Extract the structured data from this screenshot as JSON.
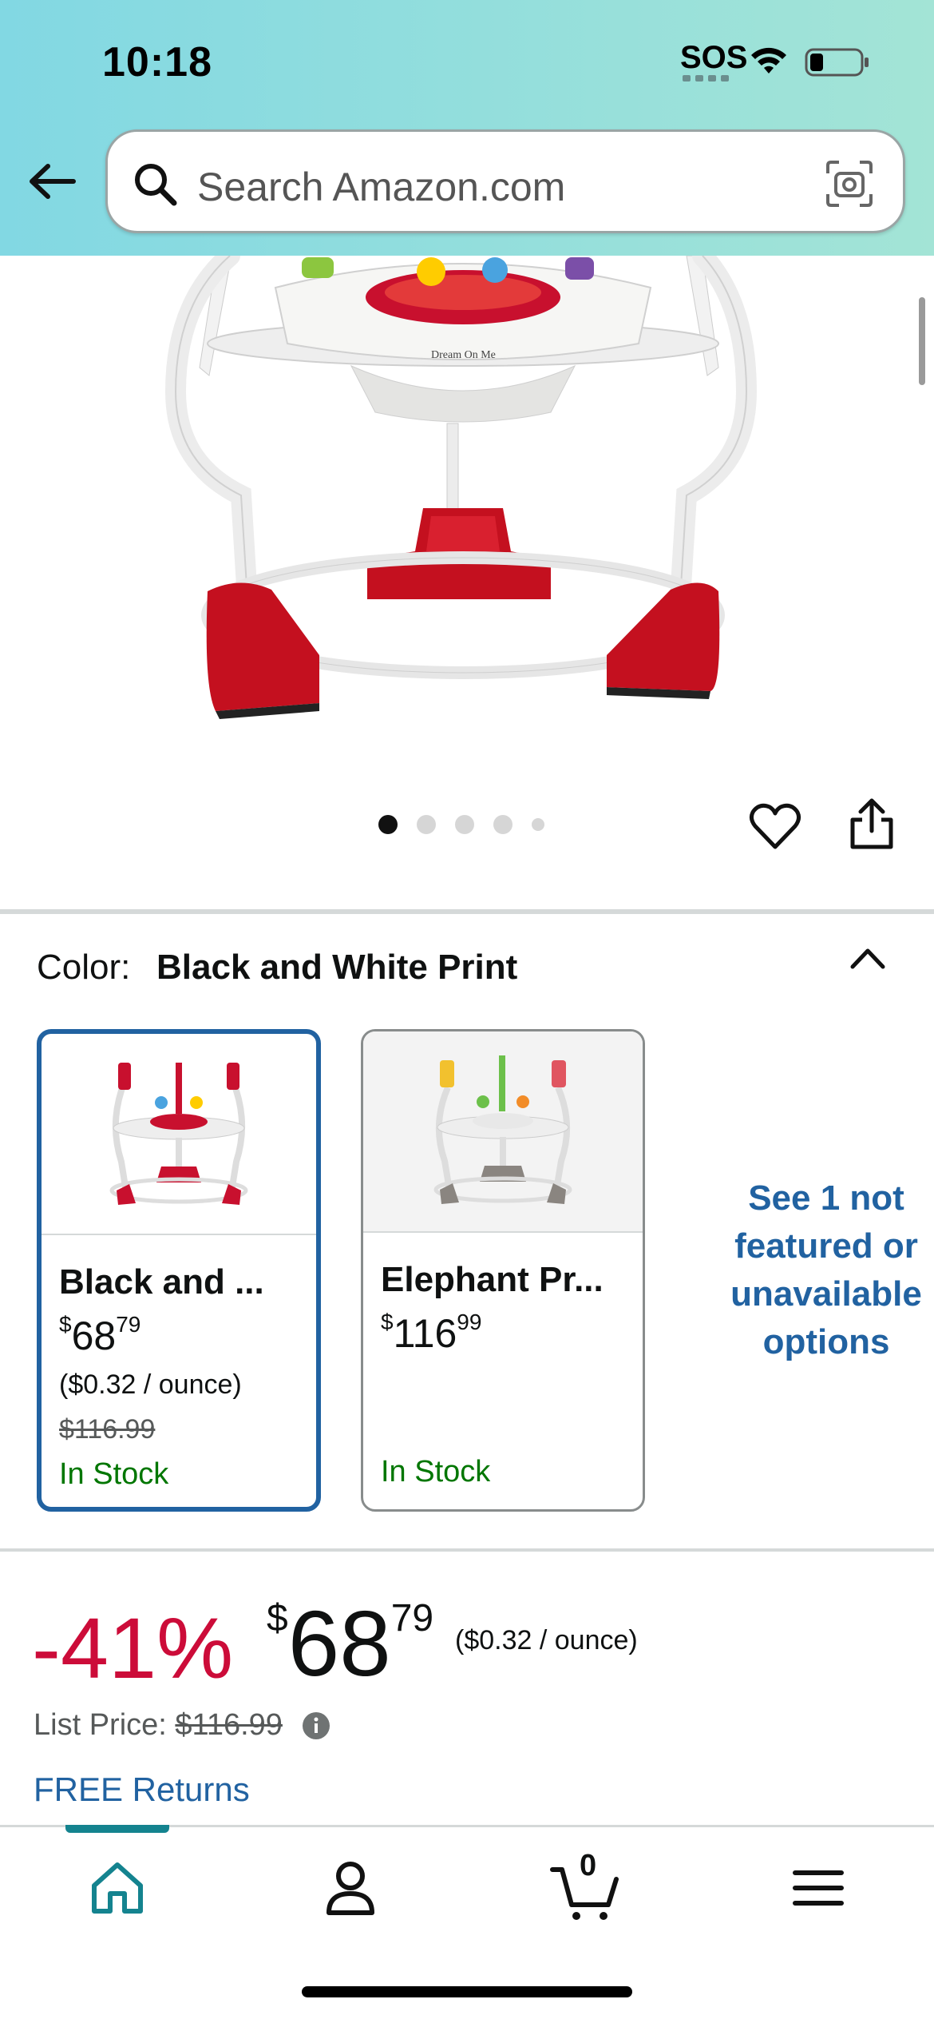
{
  "status_bar": {
    "time": "10:18",
    "sos": "SOS"
  },
  "search": {
    "placeholder": "Search Amazon.com"
  },
  "product_image": {
    "brand_label": "Dream On Me"
  },
  "color": {
    "label": "Color:",
    "selected_value": "Black and White Print"
  },
  "swatches": [
    {
      "title": "Black and ...",
      "price_dollars": "68",
      "price_cents": "79",
      "unit_price": "($0.32 / ounce)",
      "list_price": "$116.99",
      "stock": "In Stock"
    },
    {
      "title": "Elephant Pr...",
      "price_dollars": "116",
      "price_cents": "99",
      "unit_price": "",
      "list_price": "",
      "stock": "In Stock"
    }
  ],
  "see_more": {
    "line1": "See 1 not",
    "line2": "featured or",
    "line3": "unavailable",
    "line4": "options"
  },
  "price": {
    "discount": "-41%",
    "currency": "$",
    "dollars": "68",
    "cents": "79",
    "per_unit": "($0.32 / ounce)",
    "list_label": "List Price:",
    "list_value": "$116.99",
    "free_returns": "FREE Returns"
  },
  "cart": {
    "count": "0"
  },
  "carousel": {
    "count": 5,
    "active_index": 0
  },
  "colors": {
    "accent": "#2162a1",
    "discount": "#cc0c39",
    "stock": "#007600",
    "nav_active": "#14838f"
  }
}
